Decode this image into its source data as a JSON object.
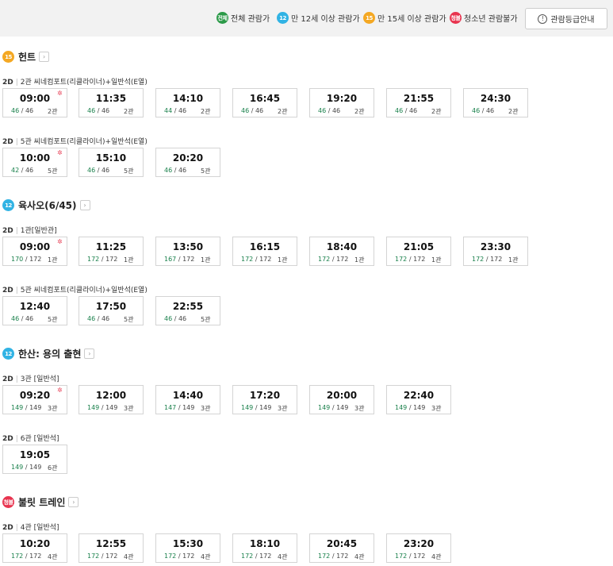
{
  "legend": [
    {
      "badge": "전체",
      "label": "전체 관람가",
      "color": "#2b9a48"
    },
    {
      "badge": "12",
      "label": "만 12세 이상 관람가",
      "color": "#31b3e4"
    },
    {
      "badge": "15",
      "label": "만 15세 이상 관람가",
      "color": "#f4a823"
    },
    {
      "badge": "청불",
      "label": "청소년 관람불가",
      "color": "#e8344f"
    }
  ],
  "guide_button": {
    "label": "관람등급안내",
    "icon": "info-icon"
  },
  "movies": [
    {
      "rating": "15",
      "rating_color": "#f4a823",
      "title": "헌트",
      "halls": [
        {
          "format": "2D",
          "hall": "2관 씨네컴포트(리클라이너)+일반석(E열)",
          "times": [
            {
              "time": "09:00",
              "remaining": "46",
              "total": "46",
              "screen": "2관",
              "morning": true
            },
            {
              "time": "11:35",
              "remaining": "46",
              "total": "46",
              "screen": "2관"
            },
            {
              "time": "14:10",
              "remaining": "44",
              "total": "46",
              "screen": "2관"
            },
            {
              "time": "16:45",
              "remaining": "46",
              "total": "46",
              "screen": "2관"
            },
            {
              "time": "19:20",
              "remaining": "46",
              "total": "46",
              "screen": "2관"
            },
            {
              "time": "21:55",
              "remaining": "46",
              "total": "46",
              "screen": "2관"
            },
            {
              "time": "24:30",
              "remaining": "46",
              "total": "46",
              "screen": "2관"
            }
          ]
        },
        {
          "format": "2D",
          "hall": "5관 씨네컴포트(리클라이너)+일반석(E열)",
          "times": [
            {
              "time": "10:00",
              "remaining": "42",
              "total": "46",
              "screen": "5관",
              "morning": true
            },
            {
              "time": "15:10",
              "remaining": "46",
              "total": "46",
              "screen": "5관"
            },
            {
              "time": "20:20",
              "remaining": "46",
              "total": "46",
              "screen": "5관"
            }
          ]
        }
      ]
    },
    {
      "rating": "12",
      "rating_color": "#31b3e4",
      "title": "육사오(6/45)",
      "halls": [
        {
          "format": "2D",
          "hall": "1관[일반관]",
          "times": [
            {
              "time": "09:00",
              "remaining": "170",
              "total": "172",
              "screen": "1관",
              "morning": true
            },
            {
              "time": "11:25",
              "remaining": "172",
              "total": "172",
              "screen": "1관"
            },
            {
              "time": "13:50",
              "remaining": "167",
              "total": "172",
              "screen": "1관"
            },
            {
              "time": "16:15",
              "remaining": "172",
              "total": "172",
              "screen": "1관"
            },
            {
              "time": "18:40",
              "remaining": "172",
              "total": "172",
              "screen": "1관"
            },
            {
              "time": "21:05",
              "remaining": "172",
              "total": "172",
              "screen": "1관"
            },
            {
              "time": "23:30",
              "remaining": "172",
              "total": "172",
              "screen": "1관"
            }
          ]
        },
        {
          "format": "2D",
          "hall": "5관 씨네컴포트(리클라이너)+일반석(E열)",
          "times": [
            {
              "time": "12:40",
              "remaining": "46",
              "total": "46",
              "screen": "5관"
            },
            {
              "time": "17:50",
              "remaining": "46",
              "total": "46",
              "screen": "5관"
            },
            {
              "time": "22:55",
              "remaining": "46",
              "total": "46",
              "screen": "5관"
            }
          ]
        }
      ]
    },
    {
      "rating": "12",
      "rating_color": "#31b3e4",
      "title": "한산: 용의 출현",
      "halls": [
        {
          "format": "2D",
          "hall": "3관 [일반석]",
          "times": [
            {
              "time": "09:20",
              "remaining": "149",
              "total": "149",
              "screen": "3관",
              "morning": true
            },
            {
              "time": "12:00",
              "remaining": "149",
              "total": "149",
              "screen": "3관"
            },
            {
              "time": "14:40",
              "remaining": "147",
              "total": "149",
              "screen": "3관"
            },
            {
              "time": "17:20",
              "remaining": "149",
              "total": "149",
              "screen": "3관"
            },
            {
              "time": "20:00",
              "remaining": "149",
              "total": "149",
              "screen": "3관"
            },
            {
              "time": "22:40",
              "remaining": "149",
              "total": "149",
              "screen": "3관"
            }
          ]
        },
        {
          "format": "2D",
          "hall": "6관 [일반석]",
          "times": [
            {
              "time": "19:05",
              "remaining": "149",
              "total": "149",
              "screen": "6관"
            }
          ]
        }
      ]
    },
    {
      "rating": "청불",
      "rating_color": "#e8344f",
      "title": "불릿 트레인",
      "halls": [
        {
          "format": "2D",
          "hall": "4관 [일반석]",
          "times": [
            {
              "time": "10:20",
              "remaining": "172",
              "total": "172",
              "screen": "4관"
            },
            {
              "time": "12:55",
              "remaining": "172",
              "total": "172",
              "screen": "4관"
            },
            {
              "time": "15:30",
              "remaining": "172",
              "total": "172",
              "screen": "4관"
            },
            {
              "time": "18:10",
              "remaining": "172",
              "total": "172",
              "screen": "4관"
            },
            {
              "time": "20:45",
              "remaining": "172",
              "total": "172",
              "screen": "4관"
            },
            {
              "time": "23:20",
              "remaining": "172",
              "total": "172",
              "screen": "4관"
            }
          ]
        }
      ]
    }
  ]
}
